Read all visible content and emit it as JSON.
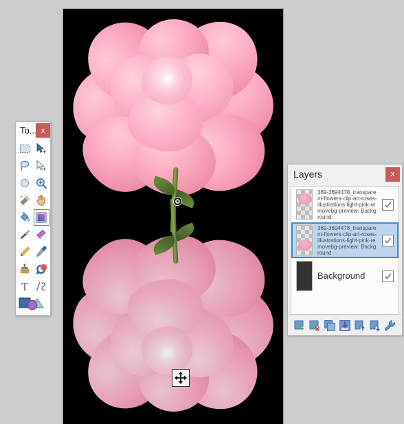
{
  "app": {
    "background_color": "#cdcdcd"
  },
  "canvas": {
    "name": "image-canvas",
    "background_color": "#000000",
    "marker_label": "transform-origin-marker",
    "cursor_label": "move-tool-cursor"
  },
  "toolbox": {
    "title": "To...",
    "close_label": "x",
    "tools": [
      {
        "id": "rectangle-select",
        "label": "Rectangle Select",
        "icon": "rectangle-select-icon",
        "selected": false
      },
      {
        "id": "move-selected",
        "label": "Move Selected",
        "icon": "move-selected-icon",
        "selected": false
      },
      {
        "id": "lasso-select",
        "label": "Lasso Select",
        "icon": "lasso-select-icon",
        "selected": false
      },
      {
        "id": "move-selection",
        "label": "Move Selection",
        "icon": "move-selection-icon",
        "selected": false
      },
      {
        "id": "ellipse-select",
        "label": "Ellipse Select",
        "icon": "ellipse-select-icon",
        "selected": false
      },
      {
        "id": "zoom",
        "label": "Zoom",
        "icon": "magnifier-icon",
        "selected": false
      },
      {
        "id": "magic-wand",
        "label": "Magic Wand",
        "icon": "magic-wand-icon",
        "selected": false
      },
      {
        "id": "pan",
        "label": "Pan",
        "icon": "hand-icon",
        "selected": false
      },
      {
        "id": "paint-bucket",
        "label": "Paint Bucket",
        "icon": "paint-bucket-icon",
        "selected": false
      },
      {
        "id": "gradient",
        "label": "Gradient",
        "icon": "gradient-icon",
        "selected": true
      },
      {
        "id": "paintbrush",
        "label": "Paintbrush",
        "icon": "paintbrush-icon",
        "selected": false
      },
      {
        "id": "eraser",
        "label": "Eraser",
        "icon": "eraser-icon",
        "selected": false
      },
      {
        "id": "pencil",
        "label": "Pencil",
        "icon": "pencil-icon",
        "selected": false
      },
      {
        "id": "color-picker",
        "label": "Color Picker",
        "icon": "eyedropper-icon",
        "selected": false
      },
      {
        "id": "clone-stamp",
        "label": "Clone Stamp",
        "icon": "clone-stamp-icon",
        "selected": false
      },
      {
        "id": "recolor",
        "label": "Recolor",
        "icon": "recolor-icon",
        "selected": false
      },
      {
        "id": "text",
        "label": "Text",
        "icon": "text-icon",
        "selected": false
      },
      {
        "id": "line-curve",
        "label": "Line / Curve",
        "icon": "line-curve-icon",
        "selected": false
      },
      {
        "id": "shapes",
        "label": "Shapes",
        "icon": "shapes-icon",
        "selected": false
      }
    ]
  },
  "layers_panel": {
    "title": "Layers",
    "close_label": "x",
    "layers": [
      {
        "name": "369-3694478_transparent-flowers-clip-art-roses-illustrations-light-pink-removebg-preview: Background",
        "visible": true,
        "selected": false,
        "thumb": "transparent-rose-top"
      },
      {
        "name": "369-3694478_transparent-flowers-clip-art-roses-illustrations-light-pink-removebg-preview: Background",
        "visible": true,
        "selected": true,
        "thumb": "transparent-rose-bottom"
      },
      {
        "name": "Background",
        "visible": true,
        "selected": false,
        "thumb": "solid-dark"
      }
    ],
    "toolbar": [
      {
        "id": "add-layer",
        "label": "Add New Layer",
        "icon": "add-layer-icon"
      },
      {
        "id": "delete-layer",
        "label": "Delete Layer",
        "icon": "delete-layer-icon"
      },
      {
        "id": "duplicate-layer",
        "label": "Duplicate Layer",
        "icon": "duplicate-layer-icon"
      },
      {
        "id": "merge-layer-down",
        "label": "Merge Layer Down",
        "icon": "merge-down-icon"
      },
      {
        "id": "move-layer-up",
        "label": "Move Layer Up",
        "icon": "move-layer-up-icon"
      },
      {
        "id": "move-layer-down",
        "label": "Move Layer Down",
        "icon": "move-layer-down-icon"
      },
      {
        "id": "layer-properties",
        "label": "Layer Properties",
        "icon": "wrench-icon"
      }
    ]
  },
  "colors": {
    "accent": "#3f8fd0",
    "close_button": "#c75b5b",
    "selection_fill": "#bcd6ef",
    "panel_bg": "#f0f0f0",
    "rose_pink": "#f2a0b8"
  }
}
